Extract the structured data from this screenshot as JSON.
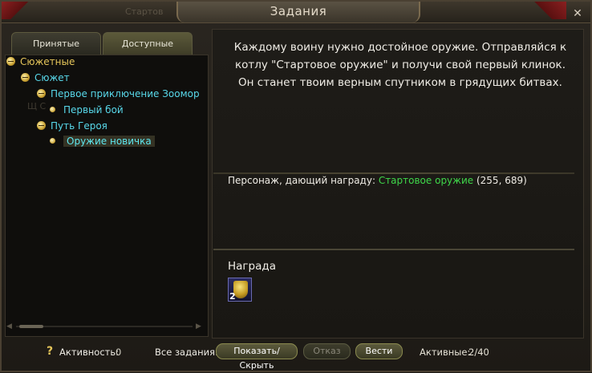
{
  "window": {
    "title": "Задания",
    "ghost_title": "Стартов",
    "ghost_left": "Щ С"
  },
  "tabs": [
    {
      "label": "Принятые"
    },
    {
      "label": "Доступные"
    }
  ],
  "tree": {
    "category": "Сюжетные",
    "group": "Сюжет",
    "chain1": "Первое приключение Зоомор",
    "chain1_quest": "Первый бой",
    "chain2": "Путь Героя",
    "chain2_quest": "Оружие новичка"
  },
  "quest": {
    "description_lines": [
      "Каждому воину нужно достойное оружие. Отправляйся к",
      "котлу \"Стартовое оружие\" и получи свой первый клинок.",
      "Он станет твоим верным спутником в грядущих битвах."
    ],
    "npc_label": "Персонаж, дающий награду:",
    "npc_name": "Стартовое оружие",
    "npc_coords": "(255, 689)",
    "reward_label": "Награда",
    "reward_count": "2"
  },
  "bottom": {
    "help": "?",
    "activity_label": "Активность:",
    "activity_value": "0",
    "all_quests_label": "Все задания:",
    "show_hide": "Показать/Скрыть",
    "decline": "Отказ",
    "track": "Вести",
    "active_label": "Активные:",
    "active_value": "2/40"
  },
  "colors": {
    "category": "#e6c65a",
    "group": "#58d8ea",
    "npc": "#3fd84a"
  }
}
